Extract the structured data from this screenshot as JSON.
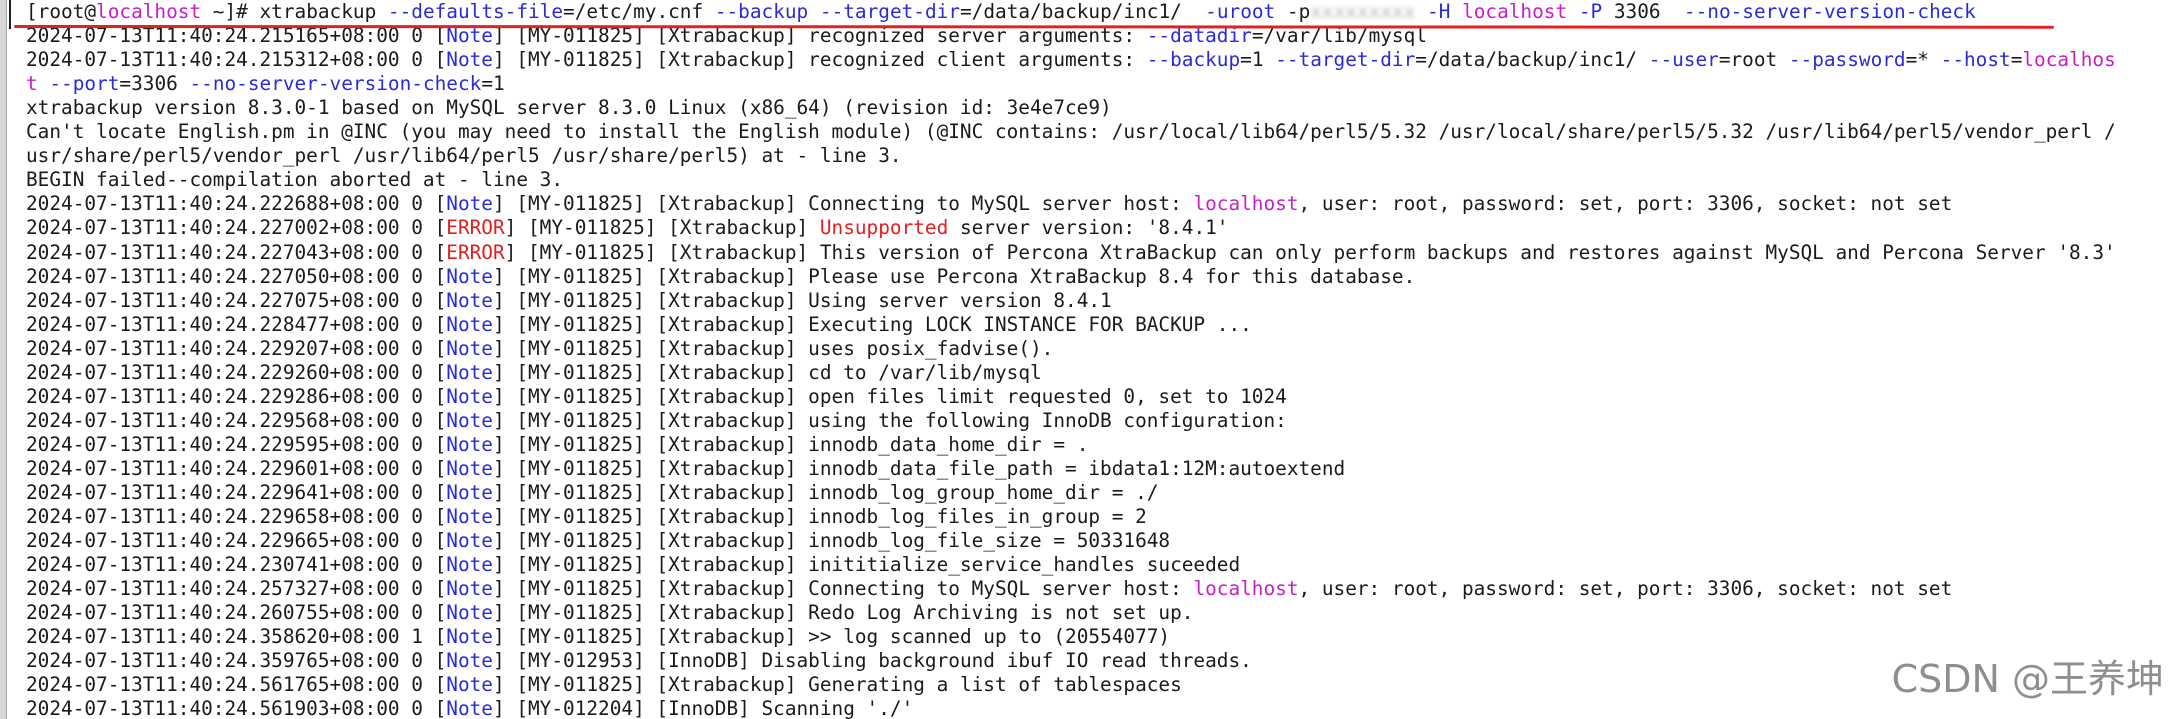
{
  "terminal": {
    "colors": {
      "text": "#1a1a1a",
      "option_blue": "#2b2bd6",
      "host_magenta": "#c81ec8",
      "error_red": "#e02020",
      "annotation_red": "#e02222",
      "background": "#ffffff"
    },
    "lines": [
      [
        {
          "t": "[root@"
        },
        {
          "t": "localhost",
          "c": "magenta"
        },
        {
          "t": " ~]# xtrabackup "
        },
        {
          "t": "--defaults-file",
          "c": "blue"
        },
        {
          "t": "=/etc/my.cnf "
        },
        {
          "t": "--backup",
          "c": "blue"
        },
        {
          "t": " "
        },
        {
          "t": "--target-dir",
          "c": "blue"
        },
        {
          "t": "=/data/backup/inc1/  "
        },
        {
          "t": "-uroot",
          "c": "blue"
        },
        {
          "t": " -p"
        },
        {
          "t": "xxxxxxxxx",
          "c": "blur"
        },
        {
          "t": " "
        },
        {
          "t": "-H",
          "c": "blue"
        },
        {
          "t": " "
        },
        {
          "t": "localhost",
          "c": "magenta"
        },
        {
          "t": " "
        },
        {
          "t": "-P",
          "c": "blue"
        },
        {
          "t": " 3306  "
        },
        {
          "t": "--no-server-version-check",
          "c": "blue"
        }
      ],
      [
        {
          "t": "2024-07-13T11:40:24.215165+08:00 0 ["
        },
        {
          "t": "Note",
          "c": "blue"
        },
        {
          "t": "] [MY-011825] [Xtrabackup] recognized server arguments: "
        },
        {
          "t": "--datadir",
          "c": "blue"
        },
        {
          "t": "=/var/lib/mysql"
        }
      ],
      [
        {
          "t": "2024-07-13T11:40:24.215312+08:00 0 ["
        },
        {
          "t": "Note",
          "c": "blue"
        },
        {
          "t": "] [MY-011825] [Xtrabackup] recognized client arguments: "
        },
        {
          "t": "--backup",
          "c": "blue"
        },
        {
          "t": "=1 "
        },
        {
          "t": "--target-dir",
          "c": "blue"
        },
        {
          "t": "=/data/backup/inc1/ "
        },
        {
          "t": "--user",
          "c": "blue"
        },
        {
          "t": "=root "
        },
        {
          "t": "--password",
          "c": "blue"
        },
        {
          "t": "=* "
        },
        {
          "t": "--host",
          "c": "blue"
        },
        {
          "t": "="
        },
        {
          "t": "localhos",
          "c": "magenta"
        }
      ],
      [
        {
          "t": "t",
          "c": "magenta"
        },
        {
          "t": " "
        },
        {
          "t": "--port",
          "c": "blue"
        },
        {
          "t": "=3306 "
        },
        {
          "t": "--no-server-version-check",
          "c": "blue"
        },
        {
          "t": "=1"
        }
      ],
      [
        {
          "t": "xtrabackup version 8.3.0-1 based on MySQL server 8.3.0 Linux (x86_64) (revision id: 3e4e7ce9)"
        }
      ],
      [
        {
          "t": "Can't locate English.pm in @INC (you may need to install the English module) (@INC contains: /usr/local/lib64/perl5/5.32 /usr/local/share/perl5/5.32 /usr/lib64/perl5/vendor_perl /"
        }
      ],
      [
        {
          "t": "usr/share/perl5/vendor_perl /usr/lib64/perl5 /usr/share/perl5) at - line 3."
        }
      ],
      [
        {
          "t": "BEGIN failed--compilation aborted at - line 3."
        }
      ],
      [
        {
          "t": "2024-07-13T11:40:24.222688+08:00 0 ["
        },
        {
          "t": "Note",
          "c": "blue"
        },
        {
          "t": "] [MY-011825] [Xtrabackup] Connecting to MySQL server host: "
        },
        {
          "t": "localhost",
          "c": "magenta"
        },
        {
          "t": ", user: root, password: set, port: 3306, socket: not set"
        }
      ],
      [
        {
          "t": "2024-07-13T11:40:24.227002+08:00 0 ["
        },
        {
          "t": "ERROR",
          "c": "red"
        },
        {
          "t": "] [MY-011825] [Xtrabackup] "
        },
        {
          "t": "Unsupported",
          "c": "red"
        },
        {
          "t": " server version: '8.4.1'"
        }
      ],
      [
        {
          "t": "2024-07-13T11:40:24.227043+08:00 0 ["
        },
        {
          "t": "ERROR",
          "c": "red"
        },
        {
          "t": "] [MY-011825] [Xtrabackup] This version of Percona XtraBackup can only perform backups and restores against MySQL and Percona Server '8.3'"
        }
      ],
      [
        {
          "t": "2024-07-13T11:40:24.227050+08:00 0 ["
        },
        {
          "t": "Note",
          "c": "blue"
        },
        {
          "t": "] [MY-011825] [Xtrabackup] Please use Percona XtraBackup 8.4 for this database."
        }
      ],
      [
        {
          "t": "2024-07-13T11:40:24.227075+08:00 0 ["
        },
        {
          "t": "Note",
          "c": "blue"
        },
        {
          "t": "] [MY-011825] [Xtrabackup] Using server version 8.4.1"
        }
      ],
      [
        {
          "t": "2024-07-13T11:40:24.228477+08:00 0 ["
        },
        {
          "t": "Note",
          "c": "blue"
        },
        {
          "t": "] [MY-011825] [Xtrabackup] Executing LOCK INSTANCE FOR BACKUP ..."
        }
      ],
      [
        {
          "t": "2024-07-13T11:40:24.229207+08:00 0 ["
        },
        {
          "t": "Note",
          "c": "blue"
        },
        {
          "t": "] [MY-011825] [Xtrabackup] uses posix_fadvise()."
        }
      ],
      [
        {
          "t": "2024-07-13T11:40:24.229260+08:00 0 ["
        },
        {
          "t": "Note",
          "c": "blue"
        },
        {
          "t": "] [MY-011825] [Xtrabackup] cd to /var/lib/mysql"
        }
      ],
      [
        {
          "t": "2024-07-13T11:40:24.229286+08:00 0 ["
        },
        {
          "t": "Note",
          "c": "blue"
        },
        {
          "t": "] [MY-011825] [Xtrabackup] open files limit requested 0, set to 1024"
        }
      ],
      [
        {
          "t": "2024-07-13T11:40:24.229568+08:00 0 ["
        },
        {
          "t": "Note",
          "c": "blue"
        },
        {
          "t": "] [MY-011825] [Xtrabackup] using the following InnoDB configuration:"
        }
      ],
      [
        {
          "t": "2024-07-13T11:40:24.229595+08:00 0 ["
        },
        {
          "t": "Note",
          "c": "blue"
        },
        {
          "t": "] [MY-011825] [Xtrabackup] innodb_data_home_dir = ."
        }
      ],
      [
        {
          "t": "2024-07-13T11:40:24.229601+08:00 0 ["
        },
        {
          "t": "Note",
          "c": "blue"
        },
        {
          "t": "] [MY-011825] [Xtrabackup] innodb_data_file_path = ibdata1:12M:autoextend"
        }
      ],
      [
        {
          "t": "2024-07-13T11:40:24.229641+08:00 0 ["
        },
        {
          "t": "Note",
          "c": "blue"
        },
        {
          "t": "] [MY-011825] [Xtrabackup] innodb_log_group_home_dir = ./"
        }
      ],
      [
        {
          "t": "2024-07-13T11:40:24.229658+08:00 0 ["
        },
        {
          "t": "Note",
          "c": "blue"
        },
        {
          "t": "] [MY-011825] [Xtrabackup] innodb_log_files_in_group = 2"
        }
      ],
      [
        {
          "t": "2024-07-13T11:40:24.229665+08:00 0 ["
        },
        {
          "t": "Note",
          "c": "blue"
        },
        {
          "t": "] [MY-011825] [Xtrabackup] innodb_log_file_size = 50331648"
        }
      ],
      [
        {
          "t": "2024-07-13T11:40:24.230741+08:00 0 ["
        },
        {
          "t": "Note",
          "c": "blue"
        },
        {
          "t": "] [MY-011825] [Xtrabackup] inititialize_service_handles suceeded"
        }
      ],
      [
        {
          "t": "2024-07-13T11:40:24.257327+08:00 0 ["
        },
        {
          "t": "Note",
          "c": "blue"
        },
        {
          "t": "] [MY-011825] [Xtrabackup] Connecting to MySQL server host: "
        },
        {
          "t": "localhost",
          "c": "magenta"
        },
        {
          "t": ", user: root, password: set, port: 3306, socket: not set"
        }
      ],
      [
        {
          "t": "2024-07-13T11:40:24.260755+08:00 0 ["
        },
        {
          "t": "Note",
          "c": "blue"
        },
        {
          "t": "] [MY-011825] [Xtrabackup] Redo Log Archiving is not set up."
        }
      ],
      [
        {
          "t": "2024-07-13T11:40:24.358620+08:00 1 ["
        },
        {
          "t": "Note",
          "c": "blue"
        },
        {
          "t": "] [MY-011825] [Xtrabackup] >> log scanned up to (20554077)"
        }
      ],
      [
        {
          "t": "2024-07-13T11:40:24.359765+08:00 0 ["
        },
        {
          "t": "Note",
          "c": "blue"
        },
        {
          "t": "] [MY-012953] [InnoDB] Disabling background ibuf IO read threads."
        }
      ],
      [
        {
          "t": "2024-07-13T11:40:24.561765+08:00 0 ["
        },
        {
          "t": "Note",
          "c": "blue"
        },
        {
          "t": "] [MY-011825] [Xtrabackup] Generating a list of tablespaces"
        }
      ],
      [
        {
          "t": "2024-07-13T11:40:24.561903+08:00 0 ["
        },
        {
          "t": "Note",
          "c": "blue"
        },
        {
          "t": "] [MY-012204] [InnoDB] Scanning './'"
        }
      ]
    ]
  },
  "watermark": {
    "text": "CSDN @王养坤"
  }
}
